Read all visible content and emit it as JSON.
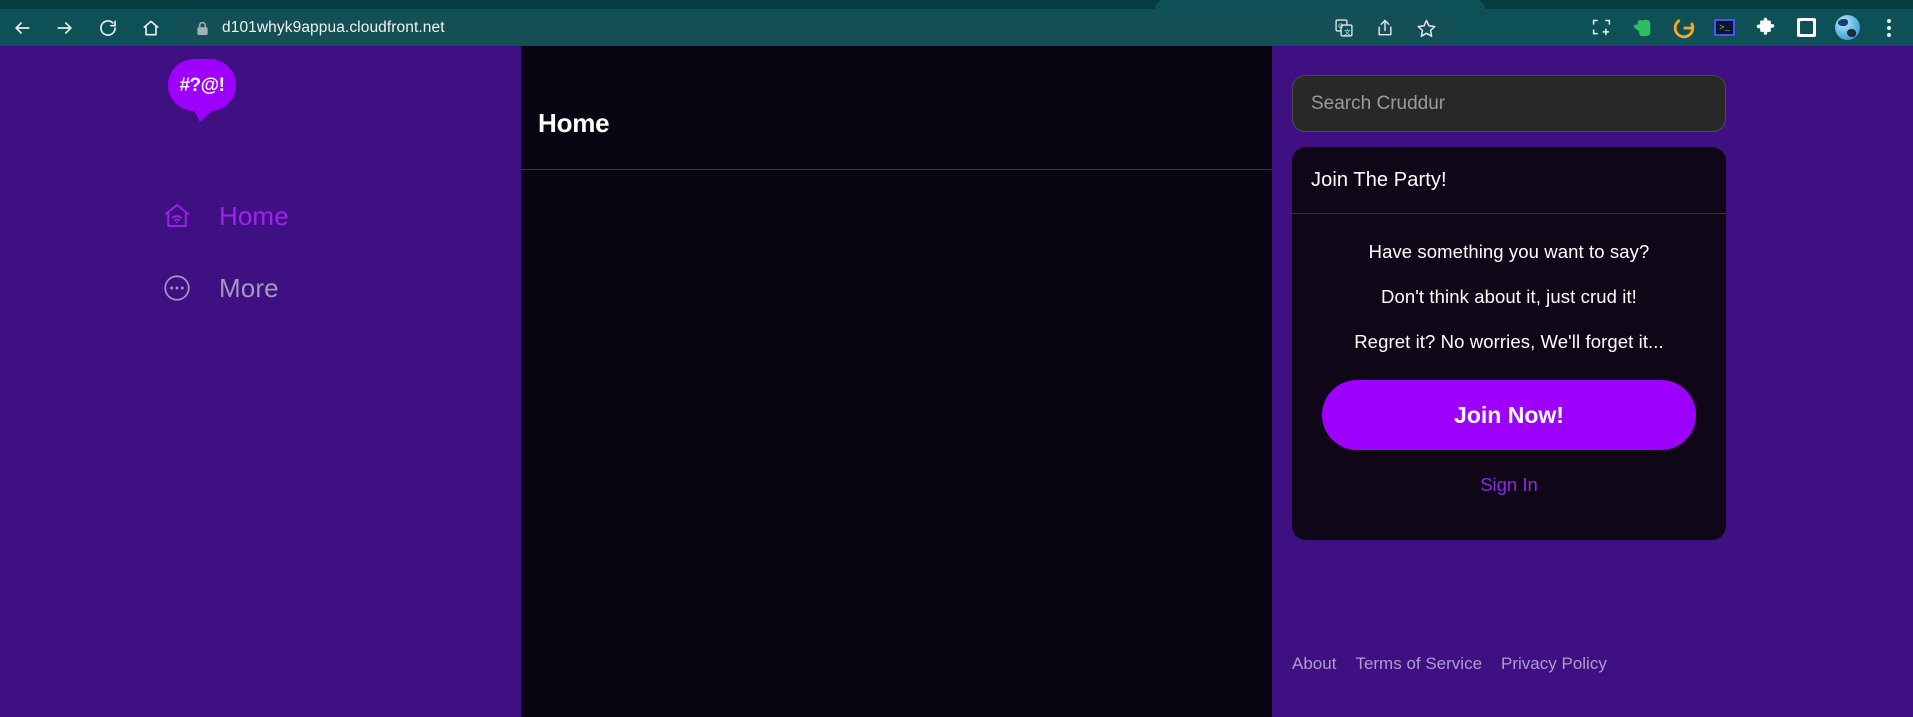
{
  "browser": {
    "nav": {
      "back": "back-arrow",
      "forward": "forward-arrow",
      "reload": "reload",
      "home": "home"
    },
    "omnibox": {
      "url": "d101whyk9appua.cloudfront.net",
      "lock_icon": "padlock-secure",
      "actions": [
        {
          "name": "translate-icon",
          "label": "Translate this page"
        },
        {
          "name": "share-icon",
          "label": "Share this page"
        },
        {
          "name": "bookmark-star-icon",
          "label": "Bookmark this tab"
        }
      ]
    },
    "toolbar_icons": [
      {
        "name": "screenshot-capture-icon",
        "label": "Capture"
      },
      {
        "name": "evernote-extension-icon",
        "label": "Evernote Web Clipper"
      },
      {
        "name": "grammarly-extension-icon",
        "label": "Grammarly"
      },
      {
        "name": "terminal-extension-icon",
        "label": "Terminal"
      },
      {
        "name": "extensions-puzzle-icon",
        "label": "Extensions"
      },
      {
        "name": "side-panel-icon",
        "label": "Side panel"
      },
      {
        "name": "profile-avatar-icon",
        "label": "Profile"
      },
      {
        "name": "chrome-menu-kebab-icon",
        "label": "Customize and control"
      }
    ]
  },
  "sidebar": {
    "logo": {
      "text": "#?@!",
      "icon": "speech-bubble-logo"
    },
    "items": [
      {
        "label": "Home",
        "icon": "house-wifi-icon",
        "state": "active"
      },
      {
        "label": "More",
        "icon": "circle-ellipsis-icon",
        "state": "inactive"
      }
    ]
  },
  "main": {
    "title": "Home"
  },
  "right_rail": {
    "search": {
      "placeholder": "Search Cruddur",
      "value": ""
    },
    "join_panel": {
      "title": "Join The Party!",
      "lines": [
        "Have something you want to say?",
        "Don't think about it, just crud it!",
        "Regret it? No worries, We'll forget it..."
      ],
      "join_button_label": "Join Now!",
      "sign_in_label": "Sign In"
    },
    "footer_links": [
      {
        "label": "About"
      },
      {
        "label": "Terms of Service"
      },
      {
        "label": "Privacy Policy"
      }
    ]
  },
  "colors": {
    "brand_purple": "#9d00ff",
    "sidebar_purple": "#3f1082",
    "panel_dark": "#0f0617",
    "main_dark": "#0a0513",
    "browser_teal": "#0d5055",
    "active_nav": "#a020f0",
    "sign_in": "#8a2be2"
  }
}
